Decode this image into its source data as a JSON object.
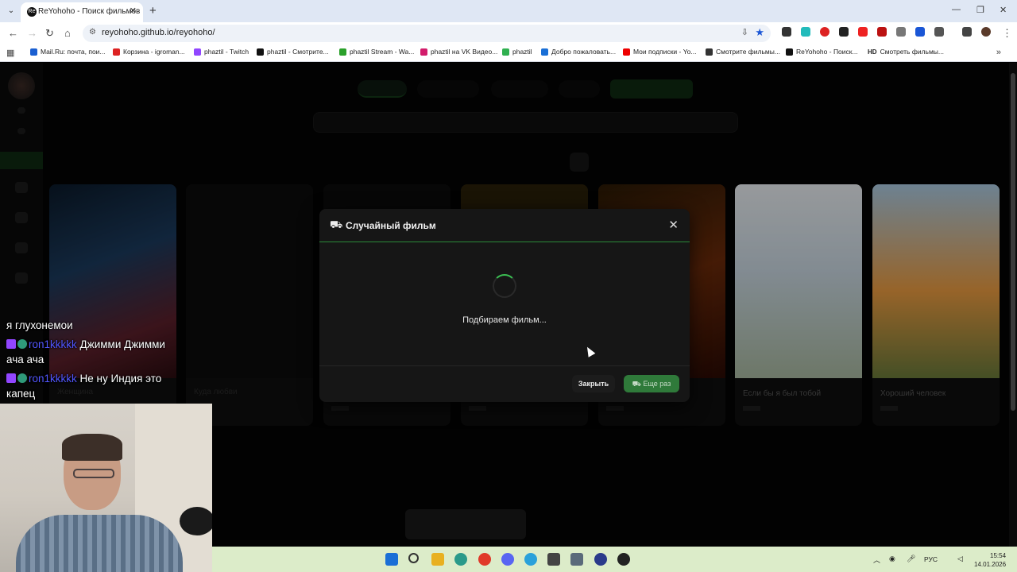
{
  "browser": {
    "tab_title": "ReYohoho - Поиск фильмов",
    "tab_favicon": "Re",
    "url": "reyohoho.github.io/reyohoho/",
    "bookmarks": [
      {
        "label": "Mail.Ru: почта, пои...",
        "color": "#1a5fd1"
      },
      {
        "label": "Корзина - igroman...",
        "color": "#d22"
      },
      {
        "label": "phaztil - Twitch",
        "color": "#9146ff"
      },
      {
        "label": "phaztil - Смотрите...",
        "color": "#111"
      },
      {
        "label": "phaztil Stream - Wa...",
        "color": "#2aa02a"
      },
      {
        "label": "phaztil на VK Видео...",
        "color": "#d21c6b"
      },
      {
        "label": "phaztil",
        "color": "#30b050"
      },
      {
        "label": "Добро пожаловать...",
        "color": "#1a6fd6"
      },
      {
        "label": "Мои подписки - Yo...",
        "color": "#e00"
      },
      {
        "label": "Смотрите фильмы...",
        "color": "#333"
      },
      {
        "label": "ReYohoho - Поиск...",
        "color": "#111"
      },
      {
        "label": "Смотреть фильмы...",
        "color": "#222",
        "prefix": "HD"
      }
    ]
  },
  "modal": {
    "title": "Случайный фильм",
    "status": "Подбираем фильм...",
    "close_label": "Закрыть",
    "again_label": "Еще раз",
    "accent_color": "#3bbd52"
  },
  "cards": [
    {
      "title": "Женщина"
    },
    {
      "title": "Куда любви"
    },
    {
      "title": ""
    },
    {
      "title": ""
    },
    {
      "title": ""
    },
    {
      "title": "Если бы я был тобой"
    },
    {
      "title": "Хороший человек"
    }
  ],
  "chat": [
    {
      "user": "",
      "text": "я глухонемои"
    },
    {
      "user": "ron1kkkkk",
      "text": "Джимми Джимми"
    },
    {
      "user": "",
      "text": "ача ача"
    },
    {
      "user": "ron1kkkkk",
      "text": "Не ну Индия это"
    },
    {
      "user": "",
      "text": "капец"
    }
  ],
  "taskbar": {
    "lang": "РУС",
    "time": "15:54",
    "date": "14.01.2026"
  }
}
